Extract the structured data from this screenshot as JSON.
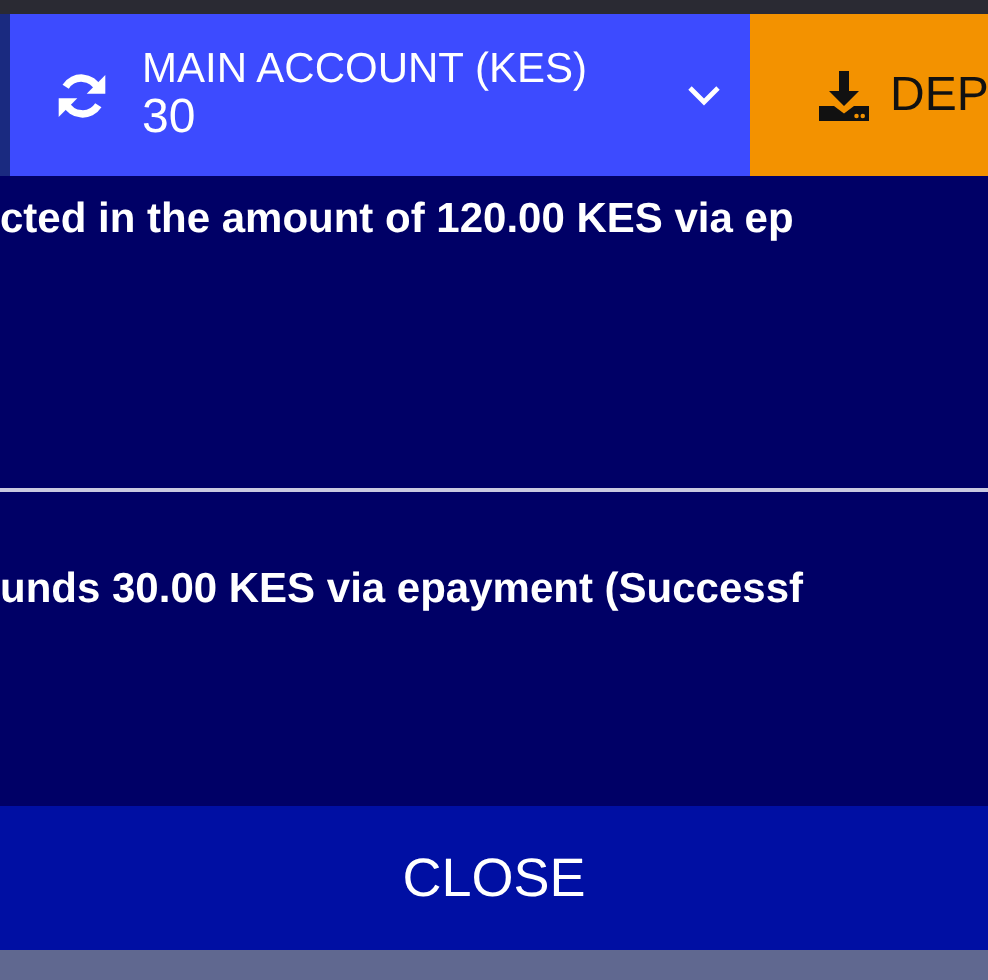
{
  "account": {
    "label": "MAIN ACCOUNT (KES)",
    "balance": "30"
  },
  "deposit": {
    "label": "DEP"
  },
  "messages": [
    {
      "text": "cted in the amount of 120.00 KES via ep"
    },
    {
      "text": "unds 30.00 KES via epayment (Successf"
    }
  ],
  "close_button": "CLOSE"
}
